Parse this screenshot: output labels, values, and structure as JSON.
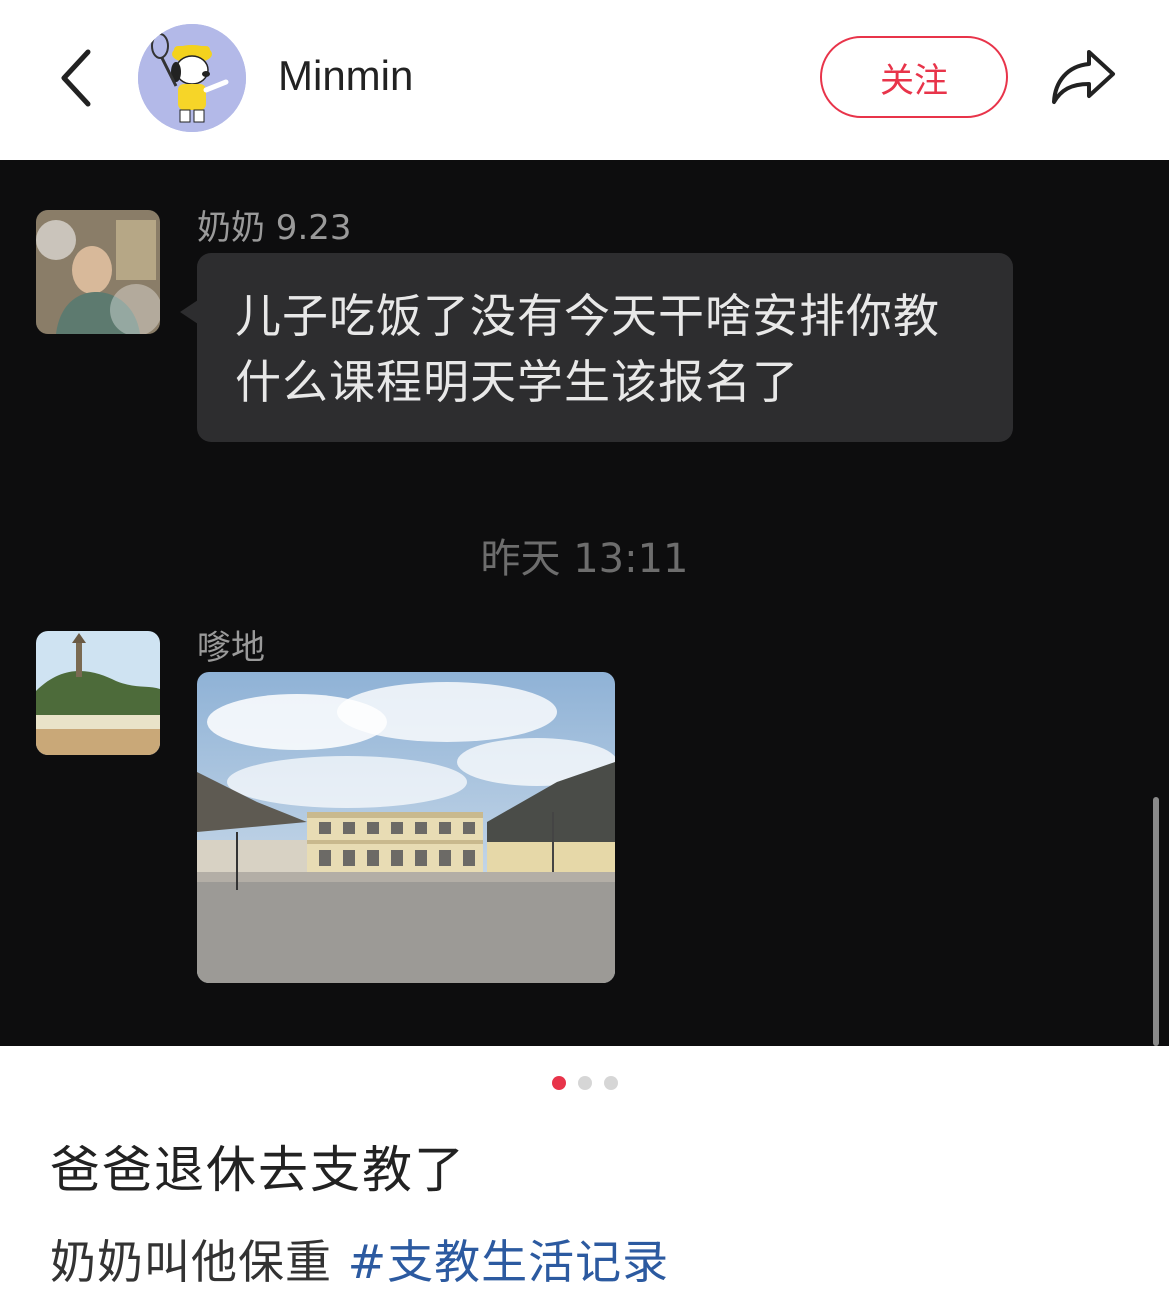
{
  "header": {
    "username": "Minmin",
    "follow_label": "关注",
    "back_icon": "chevron-left-icon",
    "share_icon": "share-arrow-icon"
  },
  "chat": {
    "first_sender": "奶奶 9.23",
    "first_message": "儿子吃饭了没有今天干啥安排你教什么课程明天学生该报名了",
    "timestamp": "昨天 13:11",
    "second_sender": "嗲地"
  },
  "carousel": {
    "total": 3,
    "active_index": 0
  },
  "post": {
    "title": "爸爸退休去支教了",
    "desc": "奶奶叫他保重",
    "hashtag": "#支教生活记录"
  },
  "colors": {
    "accent": "#e8344a",
    "hashtag": "#2c5aa0",
    "chat_bg": "#0d0d0e",
    "bubble_bg": "#2d2d2f"
  }
}
